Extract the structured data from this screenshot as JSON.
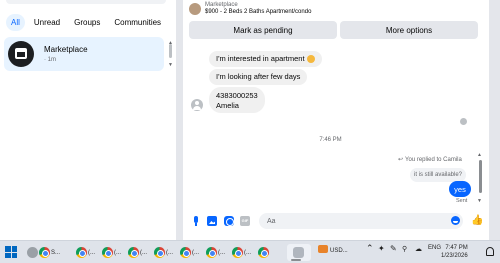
{
  "left_panel": {
    "filters": [
      "All",
      "Unread",
      "Groups",
      "Communities"
    ],
    "conversation": {
      "name": "Marketplace",
      "time": "· 1m"
    }
  },
  "listing": {
    "source": "Marketplace",
    "title": "$900 - 2 Beds 2 Baths Apartment/condo",
    "mark_pending_label": "Mark as pending",
    "more_options_label": "More options"
  },
  "messages": {
    "incoming": [
      {
        "text": "I'm interested in apartment"
      },
      {
        "text": "I'm looking after few days"
      },
      {
        "line1": "4383000253",
        "line2": "Amelia"
      }
    ],
    "timestamp": "7:46 PM",
    "reply_note": "You replied to Camila",
    "quoted_text": "it is still available?",
    "outgoing": "yes",
    "status": "Sent"
  },
  "composer": {
    "placeholder": "Aa",
    "gif_label": "GIF"
  },
  "taskbar": {
    "apps": [
      "S...",
      "(...",
      "(...",
      "(...",
      "(...",
      "(...",
      "(...",
      "(..."
    ],
    "tray_ticker": "USD...",
    "language": "ENG",
    "time": "7:47 PM",
    "date": "1/23/2026"
  },
  "colors": {
    "accent": "#0866ff",
    "bubble": "#f0f0f0",
    "selected": "#e7f3ff"
  }
}
